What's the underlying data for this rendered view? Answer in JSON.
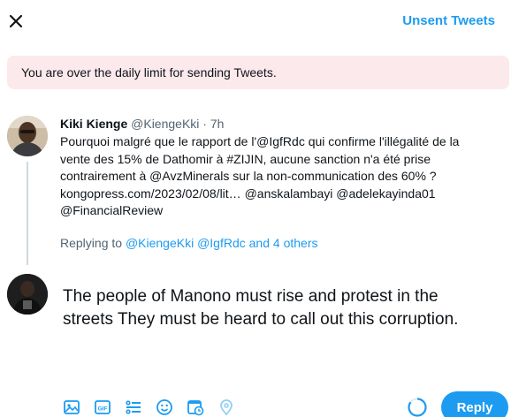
{
  "header": {
    "close_icon": "close-icon",
    "unsent_label": "Unsent Tweets"
  },
  "banner": {
    "text": "You are over the daily limit for sending Tweets.",
    "color": "#fbe9ec"
  },
  "original_tweet": {
    "name": "Kiki Kienge",
    "handle": "@KiengeKki",
    "separator": "·",
    "time": "7h",
    "lines": [
      "Pourquoi malgré que le rapport de l'@IgfRdc qui confirme l'illégalité de la",
      "vente des 15% de Dathomir à #ZIJIN, aucune sanction n'a été prise",
      "contrairement à @AvzMinerals sur la non-communication des 60% ?",
      "kongopress.com/2023/02/08/lit…  @anskalambayi @adelekayinda01",
      "@FinancialReview"
    ]
  },
  "replying_to": {
    "prefix": "Replying to",
    "targets": "@KiengeKki @IgfRdc and 4 others"
  },
  "reply": {
    "lines": [
      "The people of Manono must rise and protest in the",
      "streets They must be heard to call out this corruption."
    ]
  },
  "toolbar": {
    "icons": [
      "image-icon",
      "gif-icon",
      "poll-icon",
      "emoji-icon",
      "schedule-icon",
      "location-icon"
    ],
    "reply_label": "Reply",
    "accent": "#1d9bf0"
  },
  "progress_ring": {
    "fraction": 0.85
  }
}
